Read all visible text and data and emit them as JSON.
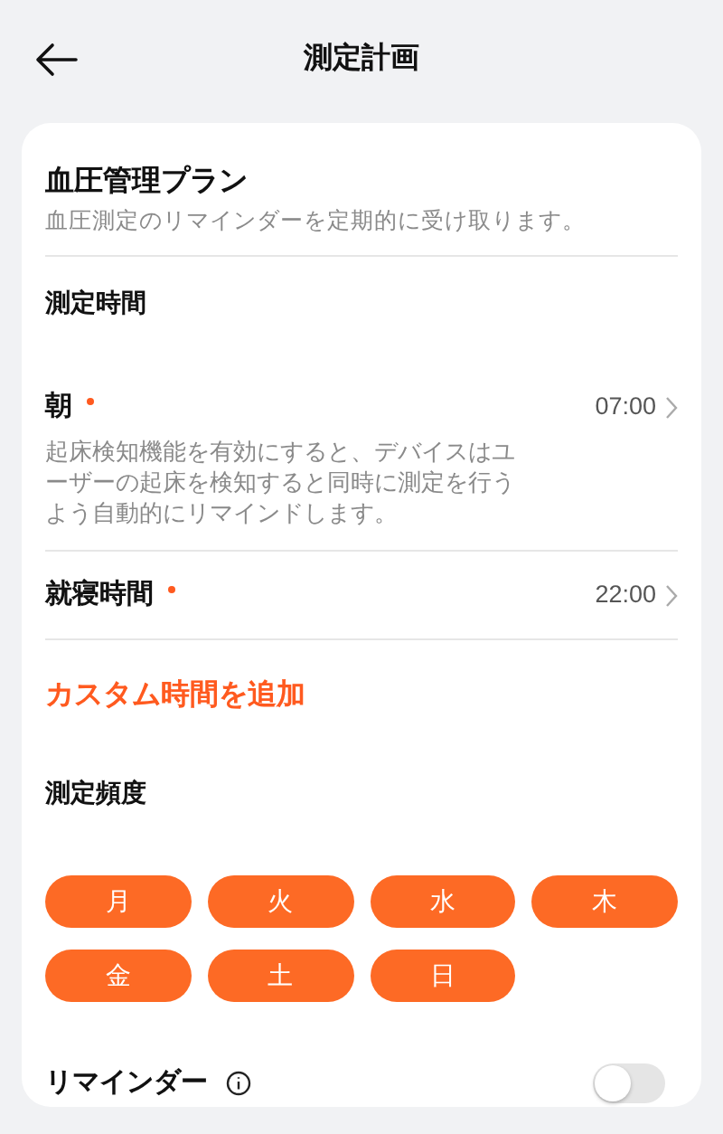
{
  "header": {
    "title": "測定計画"
  },
  "plan": {
    "title": "血圧管理プラン",
    "subtitle": "血圧測定のリマインダーを定期的に受け取ります。"
  },
  "time_section": {
    "title": "測定時間"
  },
  "times": [
    {
      "label": "朝",
      "required": true,
      "value": "07:00",
      "description": "起床検知機能を有効にすると、デバイスはユーザーの起床を検知すると同時に測定を行うよう自動的にリマインドします。"
    },
    {
      "label": "就寝時間",
      "required": true,
      "value": "22:00"
    }
  ],
  "add_custom": "カスタム時間を追加",
  "frequency": {
    "title": "測定頻度",
    "days": [
      {
        "label": "月",
        "selected": true
      },
      {
        "label": "火",
        "selected": true
      },
      {
        "label": "水",
        "selected": true
      },
      {
        "label": "木",
        "selected": true
      },
      {
        "label": "金",
        "selected": true
      },
      {
        "label": "土",
        "selected": true
      },
      {
        "label": "日",
        "selected": true
      }
    ]
  },
  "reminder": {
    "label": "リマインダー",
    "on": false
  }
}
